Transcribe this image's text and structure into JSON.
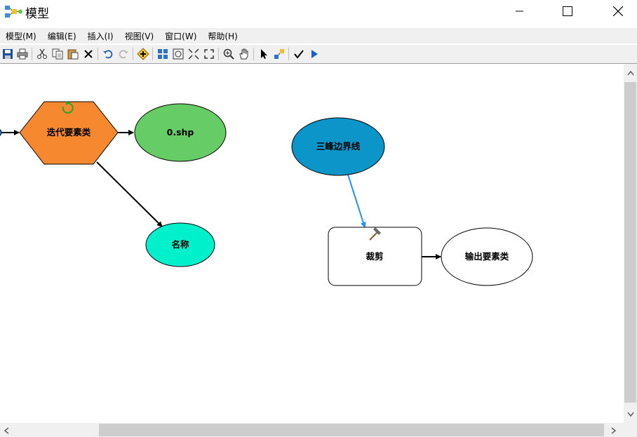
{
  "window": {
    "title": "模型",
    "controls": {
      "minimize": "—",
      "maximize": "☐",
      "close": "✕"
    }
  },
  "menu": {
    "items": [
      "模型(M)",
      "编辑(E)",
      "插入(I)",
      "视图(V)",
      "窗口(W)",
      "帮助(H)"
    ]
  },
  "toolbar": {
    "buttons": [
      "save-icon",
      "print-icon",
      "cut-icon",
      "copy-icon",
      "paste-icon",
      "delete-icon",
      "undo-icon",
      "redo-icon",
      "add-data-icon",
      "auto-layout-icon",
      "full-extent-icon",
      "fixed-zoom-in-icon",
      "fixed-zoom-out-icon",
      "zoom-in-icon",
      "pan-icon",
      "select-icon",
      "connect-icon",
      "validate-icon",
      "run-icon"
    ]
  },
  "model": {
    "nodes": {
      "iterate": "迭代要素类",
      "output_shp": "0.shp",
      "name": "名称",
      "boundary": "三峰边界线",
      "clip": "裁剪",
      "output_fc": "输出要素类"
    },
    "colors": {
      "iterate": "#f6882f",
      "output_shp": "#66cc66",
      "name": "#00f0cc",
      "boundary": "#0b95c8",
      "clip": "#ffffff",
      "output_fc": "#ffffff",
      "link_blue": "#1e90ff"
    }
  }
}
